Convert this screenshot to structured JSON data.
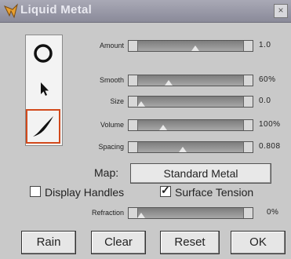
{
  "window": {
    "title": "Liquid Metal",
    "close_glyph": "×"
  },
  "tools": [
    {
      "name": "circle-tool",
      "icon": "circle-icon"
    },
    {
      "name": "arrow-tool",
      "icon": "arrow-pointer-icon"
    },
    {
      "name": "brush-tool",
      "icon": "brush-stroke-icon",
      "selected": true
    }
  ],
  "sliders": {
    "amount": {
      "label": "Amount",
      "value_text": "1.0",
      "level": 0.55
    },
    "smooth": {
      "label": "Smooth",
      "value_text": "60%",
      "level": 0.28
    },
    "size": {
      "label": "Size",
      "value_text": "0.0",
      "level": 0.0
    },
    "volume": {
      "label": "Volume",
      "value_text": "100%",
      "level": 0.22
    },
    "spacing": {
      "label": "Spacing",
      "value_text": "0.808",
      "level": 0.42
    },
    "refraction": {
      "label": "Refraction",
      "value_text": "0%",
      "level": 0.0
    }
  },
  "map": {
    "label": "Map:",
    "value": "Standard Metal"
  },
  "options": {
    "display_handles": {
      "label": "Display Handles",
      "checked": false
    },
    "surface_tension": {
      "label": "Surface Tension",
      "checked": true
    }
  },
  "buttons": {
    "rain": "Rain",
    "clear": "Clear",
    "reset": "Reset",
    "ok": "OK"
  },
  "colors": {
    "selection_border": "#d24a1c",
    "titlebar": "#9a9aa8"
  }
}
